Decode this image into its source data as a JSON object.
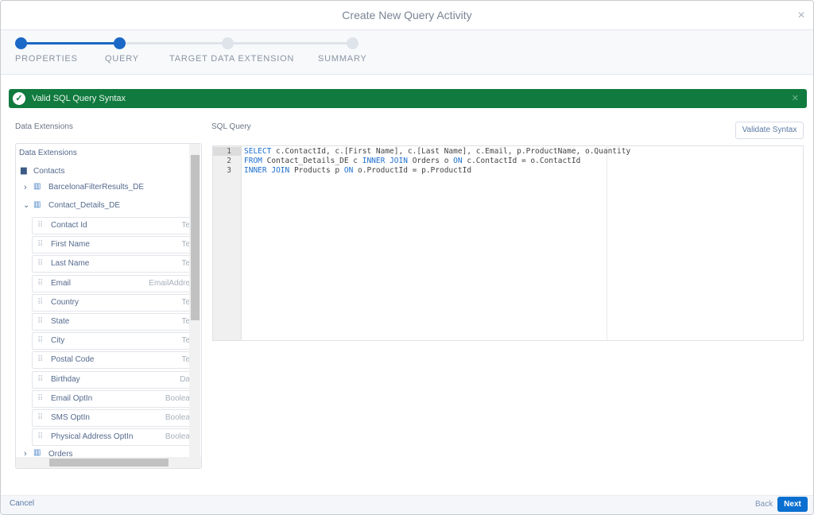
{
  "header": {
    "title": "Create New Query Activity",
    "close_icon": "close-icon"
  },
  "stepper": {
    "steps": [
      {
        "label": "PROPERTIES",
        "state": "complete"
      },
      {
        "label": "QUERY",
        "state": "active"
      },
      {
        "label": "TARGET DATA EXTENSION",
        "state": "pending"
      },
      {
        "label": "SUMMARY",
        "state": "pending"
      }
    ],
    "active_color": "#1b68c6",
    "pending_color": "#dfe3ea"
  },
  "banner": {
    "message": "Valid SQL Query Syntax",
    "color": "#117a3e"
  },
  "left": {
    "section_label": "Data Extensions",
    "tree_header": "Data Extensions",
    "folder": "Contacts",
    "items": [
      {
        "name": "BarcelonaFilterResults_DE",
        "expanded": false
      },
      {
        "name": "Contact_Details_DE",
        "expanded": true
      }
    ],
    "fields": [
      {
        "name": "Contact Id",
        "type": "Te"
      },
      {
        "name": "First Name",
        "type": "Te"
      },
      {
        "name": "Last Name",
        "type": "Te"
      },
      {
        "name": "Email",
        "type": "EmailAddre"
      },
      {
        "name": "Country",
        "type": "Te"
      },
      {
        "name": "State",
        "type": "Te"
      },
      {
        "name": "City",
        "type": "Te"
      },
      {
        "name": "Postal Code",
        "type": "Te"
      },
      {
        "name": "Birthday",
        "type": "Da"
      },
      {
        "name": "Email OptIn",
        "type": "Boolea"
      },
      {
        "name": "SMS OptIn",
        "type": "Boolea"
      },
      {
        "name": "Physical Address OptIn",
        "type": "Boolea"
      }
    ],
    "after": "Orders"
  },
  "query": {
    "section_label": "SQL Query",
    "validate_label": "Validate Syntax",
    "lines": [
      "SELECT c.ContactId, c.[First Name], c.[Last Name], c.Email, p.ProductName, o.Quantity",
      "FROM Contact_Details_DE c INNER JOIN Orders o ON c.ContactId = o.ContactId",
      "INNER JOIN Products p ON o.ProductId = p.ProductId"
    ],
    "line_numbers": [
      "1",
      "2",
      "3"
    ]
  },
  "footer": {
    "cancel": "Cancel",
    "back": "Back",
    "next": "Next"
  }
}
